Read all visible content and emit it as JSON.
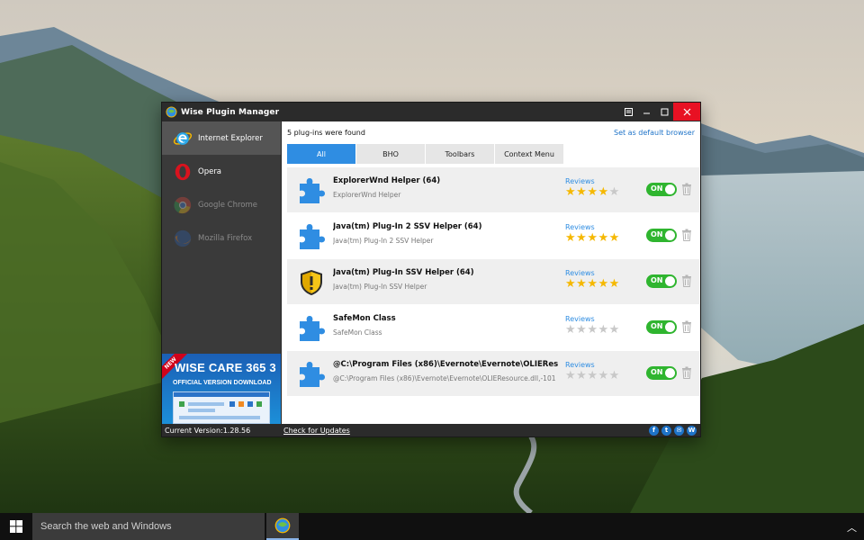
{
  "window": {
    "title": "Wise Plugin Manager"
  },
  "sidebar": {
    "browsers": [
      {
        "label": "Internet Explorer",
        "icon": "internet-explorer-icon",
        "state": "active"
      },
      {
        "label": "Opera",
        "icon": "opera-icon",
        "state": "enabled"
      },
      {
        "label": "Google Chrome",
        "icon": "chrome-icon",
        "state": "disabled"
      },
      {
        "label": "Mozilla Firefox",
        "icon": "firefox-icon",
        "state": "disabled"
      }
    ],
    "ad": {
      "ribbon": "NEW",
      "title": "WISE CARE 365 3",
      "subtitle": "OFFICIAL VERSION DOWNLOAD"
    }
  },
  "main": {
    "found_text": "5 plug-ins were found",
    "default_link": "Set as default browser",
    "tabs": [
      {
        "label": "All",
        "active": true
      },
      {
        "label": "BHO",
        "active": false
      },
      {
        "label": "Toolbars",
        "active": false
      },
      {
        "label": "Context Menu",
        "active": false
      }
    ],
    "plugins": [
      {
        "name": "ExplorerWnd Helper (64)",
        "desc": "ExplorerWnd Helper",
        "icon": "puzzle-icon",
        "reviews": "Reviews",
        "rating": 4,
        "toggle": "ON"
      },
      {
        "name": "Java(tm) Plug-In 2 SSV Helper (64)",
        "desc": "Java(tm) Plug-In 2 SSV Helper",
        "icon": "puzzle-icon",
        "reviews": "Reviews",
        "rating": 5,
        "toggle": "ON"
      },
      {
        "name": "Java(tm) Plug-In SSV Helper (64)",
        "desc": "Java(tm) Plug-In SSV Helper",
        "icon": "warning-shield-icon",
        "reviews": "Reviews",
        "rating": 5,
        "toggle": "ON"
      },
      {
        "name": "SafeMon Class",
        "desc": "SafeMon Class",
        "icon": "puzzle-icon",
        "reviews": "Reviews",
        "rating": 0,
        "toggle": "ON"
      },
      {
        "name": "@C:\\Program Files (x86)\\Evernote\\Evernote\\OLIEResource.dll,-101",
        "desc": "@C:\\Program Files (x86)\\Evernote\\Evernote\\OLIEResource.dll,-101",
        "icon": "puzzle-icon",
        "reviews": "Reviews",
        "rating": 0,
        "toggle": "ON"
      }
    ]
  },
  "statusbar": {
    "version": "Current Version:1.28.56",
    "update_link": "Check for Updates",
    "social": [
      "f",
      "t",
      "✉",
      "W"
    ]
  },
  "taskbar": {
    "search_placeholder": "Search the web and Windows"
  },
  "colors": {
    "accent": "#2f8de2",
    "toggle_on": "#2fb52f",
    "star_on": "#f5b800",
    "close_button": "#e81123"
  }
}
